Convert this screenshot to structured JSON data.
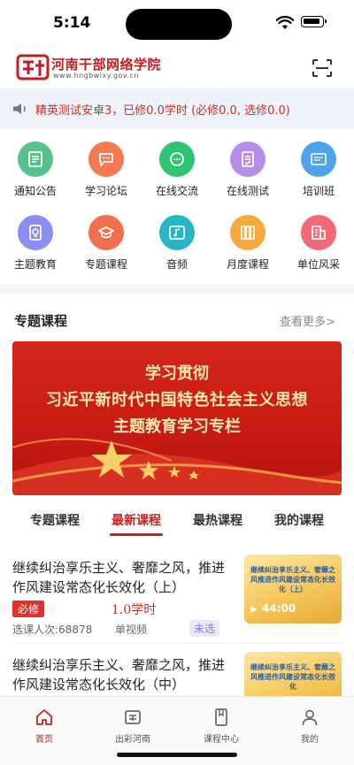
{
  "status_bar": {
    "time": "5:14"
  },
  "header": {
    "logo_name": "河南干部网络学院",
    "logo_url": "www.hngbwlxy.gov.cn",
    "scan_icon": "scan-icon"
  },
  "notice": {
    "text": "精英测试安卓3，已修0.0学时 (必修0.0, 选修0.0)"
  },
  "grid": {
    "items": [
      {
        "label": "通知公告",
        "icon": "notice-icon",
        "color": "#54c28a"
      },
      {
        "label": "学习论坛",
        "icon": "forum-icon",
        "color": "#f47b51"
      },
      {
        "label": "在线交流",
        "icon": "chat-icon",
        "color": "#2fc472"
      },
      {
        "label": "在线测试",
        "icon": "test-icon",
        "color": "#b48ee8"
      },
      {
        "label": "培训班",
        "icon": "class-icon",
        "color": "#4fa3ea"
      },
      {
        "label": "主题教育",
        "icon": "theme-icon",
        "color": "#8b8df0"
      },
      {
        "label": "专题课程",
        "icon": "special-course-icon",
        "color": "#f0704d"
      },
      {
        "label": "音频",
        "icon": "audio-icon",
        "color": "#25b7c6"
      },
      {
        "label": "月度课程",
        "icon": "monthly-course-icon",
        "color": "#f4aa3e"
      },
      {
        "label": "单位风采",
        "icon": "unit-icon",
        "color": "#f06a78"
      }
    ]
  },
  "section": {
    "title": "专题课程",
    "more": "查看更多>"
  },
  "banner": {
    "line1": "学习贯彻",
    "line2": "习近平新时代中国特色社会主义思想",
    "line3": "主题教育学习专栏"
  },
  "tabs": [
    {
      "label": "专题课程",
      "active": false
    },
    {
      "label": "最新课程",
      "active": true
    },
    {
      "label": "最热课程",
      "active": false
    },
    {
      "label": "我的课程",
      "active": false
    }
  ],
  "courses": [
    {
      "title": "继续纠治享乐主义、奢靡之风，推进作风建设常态化长效化（上）",
      "tag": "必修",
      "hours": "1.0学时",
      "count": "选课人次:68878",
      "type": "单视频",
      "status": "未选",
      "thumb_title": "继续纠治享乐主义、奢靡之风推进作风建设常态化长效化（上）",
      "duration": "44:00"
    },
    {
      "title": "继续纠治享乐主义、奢靡之风，推进作风建设常态化长效化（中）",
      "thumb_title": "继续纠治享乐主义、奢靡之风推进作风建设常态化长效化"
    }
  ],
  "bottom_nav": [
    {
      "label": "首页",
      "icon": "home-icon",
      "active": true
    },
    {
      "label": "出彩河南",
      "icon": "henan-icon",
      "active": false
    },
    {
      "label": "课程中心",
      "icon": "course-center-icon",
      "active": false
    },
    {
      "label": "我的",
      "icon": "profile-icon",
      "active": false
    }
  ],
  "colors": {
    "accent": "#c8211b",
    "notice_bg": "#eef3fb",
    "notice_text": "#d22c1e"
  }
}
